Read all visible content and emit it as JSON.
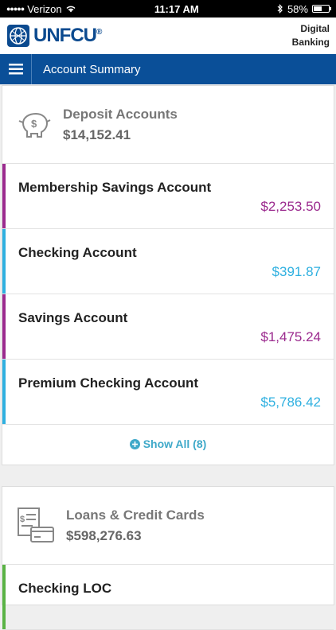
{
  "status": {
    "carrier": "Verizon",
    "time": "11:17 AM",
    "battery": "58%",
    "battery_level": 0.58
  },
  "header": {
    "logo_text": "UNFCU",
    "logo_mark": "®",
    "digital": "Digital",
    "banking": "Banking"
  },
  "nav": {
    "title": "Account Summary"
  },
  "deposit": {
    "title": "Deposit Accounts",
    "total": "$14,152.41",
    "accounts": [
      {
        "name": "Membership Savings Account",
        "amount": "$2,253.50",
        "color": "#9b2a8e"
      },
      {
        "name": "Checking Account",
        "amount": "$391.87",
        "color": "#2fb0e0"
      },
      {
        "name": "Savings Account",
        "amount": "$1,475.24",
        "color": "#9b2a8e"
      },
      {
        "name": "Premium Checking Account",
        "amount": "$5,786.42",
        "color": "#2fb0e0"
      }
    ],
    "show_all": "Show All (8)"
  },
  "loans": {
    "title": "Loans & Credit Cards",
    "total": "$598,276.63",
    "accounts": [
      {
        "name": "Checking LOC",
        "color": "#5ab345"
      }
    ]
  },
  "colors": {
    "nav": "#0a4f98",
    "brand": "#0b4a8f",
    "link": "#3fa9c9"
  }
}
